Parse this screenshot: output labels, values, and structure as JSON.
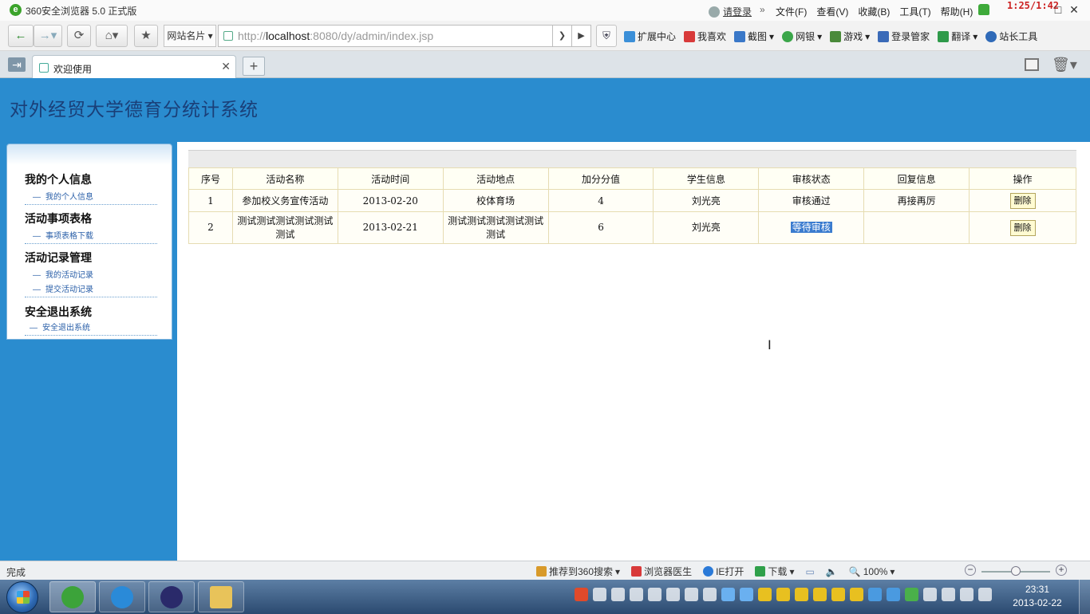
{
  "browser": {
    "title": "360安全浏览器 5.0 正式版",
    "login_label": "请登录",
    "menu": [
      "文件(F)",
      "查看(V)",
      "收藏(B)",
      "工具(T)",
      "帮助(H)"
    ],
    "clock_overlay": "1:25/1:42",
    "site_card_label": "网站名片",
    "url_prefix": "http://",
    "url_host": "localhost",
    "url_rest": ":8080/dy/admin/index.jsp",
    "toolbar_items": [
      {
        "label": "扩展中心",
        "icon": "extension-icon",
        "color": "#3b8fd8"
      },
      {
        "label": "我喜欢",
        "icon": "heart-icon",
        "color": "#d83a3a"
      },
      {
        "label": "截图",
        "icon": "screenshot-icon",
        "color": "#3a78c8"
      },
      {
        "label": "网银",
        "icon": "bank-icon",
        "color": "#3ba64a"
      },
      {
        "label": "游戏",
        "icon": "game-icon",
        "color": "#4a8a3a"
      },
      {
        "label": "登录管家",
        "icon": "key-icon",
        "color": "#3a6ab8"
      },
      {
        "label": "翻译",
        "icon": "translate-icon",
        "color": "#2f9a4a"
      },
      {
        "label": "站长工具",
        "icon": "webmaster-icon",
        "color": "#2f6ab8"
      }
    ],
    "tab_label": "欢迎使用"
  },
  "page": {
    "site_title": "对外经贸大学德育分统计系统",
    "sidebar": [
      {
        "heading": "我的个人信息",
        "links": [
          "我的个人信息"
        ]
      },
      {
        "heading": "活动事项表格",
        "links": [
          "事项表格下载"
        ]
      },
      {
        "heading": "活动记录管理",
        "links": [
          "我的活动记录",
          "提交活动记录"
        ]
      },
      {
        "heading": "安全退出系统",
        "links": [
          "安全退出系统"
        ]
      }
    ],
    "table": {
      "headers": [
        "序号",
        "活动名称",
        "活动时间",
        "活动地点",
        "加分分值",
        "学生信息",
        "审核状态",
        "回复信息",
        "操作"
      ],
      "rows": [
        {
          "no": "1",
          "name": "参加校义务宣传活动",
          "date": "2013-02-20",
          "place": "校体育场",
          "score": "4",
          "student": "刘光亮",
          "status": "审核通过",
          "reply": "再接再厉",
          "action": "删除"
        },
        {
          "no": "2",
          "name": "测试测试测试测试测试测试",
          "date": "2013-02-21",
          "place": "测试测试测试测试测试测试",
          "score": "6",
          "student": "刘光亮",
          "status": "等待审核",
          "reply": "",
          "action": "删除"
        }
      ]
    }
  },
  "statusbar": {
    "status": "完成",
    "items": [
      {
        "label": "推荐到360搜索",
        "icon": "thumb-icon",
        "color": "#d89a2a"
      },
      {
        "label": "浏览器医生",
        "icon": "doctor-icon",
        "color": "#d83a3a"
      },
      {
        "label": "IE打开",
        "icon": "ie-icon",
        "color": "#2a7ad8"
      },
      {
        "label": "下载",
        "icon": "download-icon",
        "color": "#2fa04a"
      }
    ],
    "zoom": "100%"
  },
  "taskbar": {
    "time": "23:31",
    "date": "2013-02-22"
  }
}
